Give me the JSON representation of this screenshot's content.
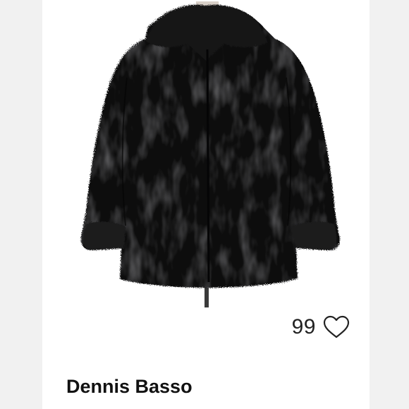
{
  "listing": {
    "image": {
      "subject": "black-faux-fur-coat-on-mannequin",
      "icon": "coat-photo"
    },
    "likes": {
      "count": "99",
      "icon": "heart-outline-icon"
    },
    "brand": "Dennis Basso"
  },
  "colors": {
    "background": "#f1f1f1",
    "card": "#ffffff",
    "coat": "#0d0d0f",
    "text": "#111111"
  }
}
